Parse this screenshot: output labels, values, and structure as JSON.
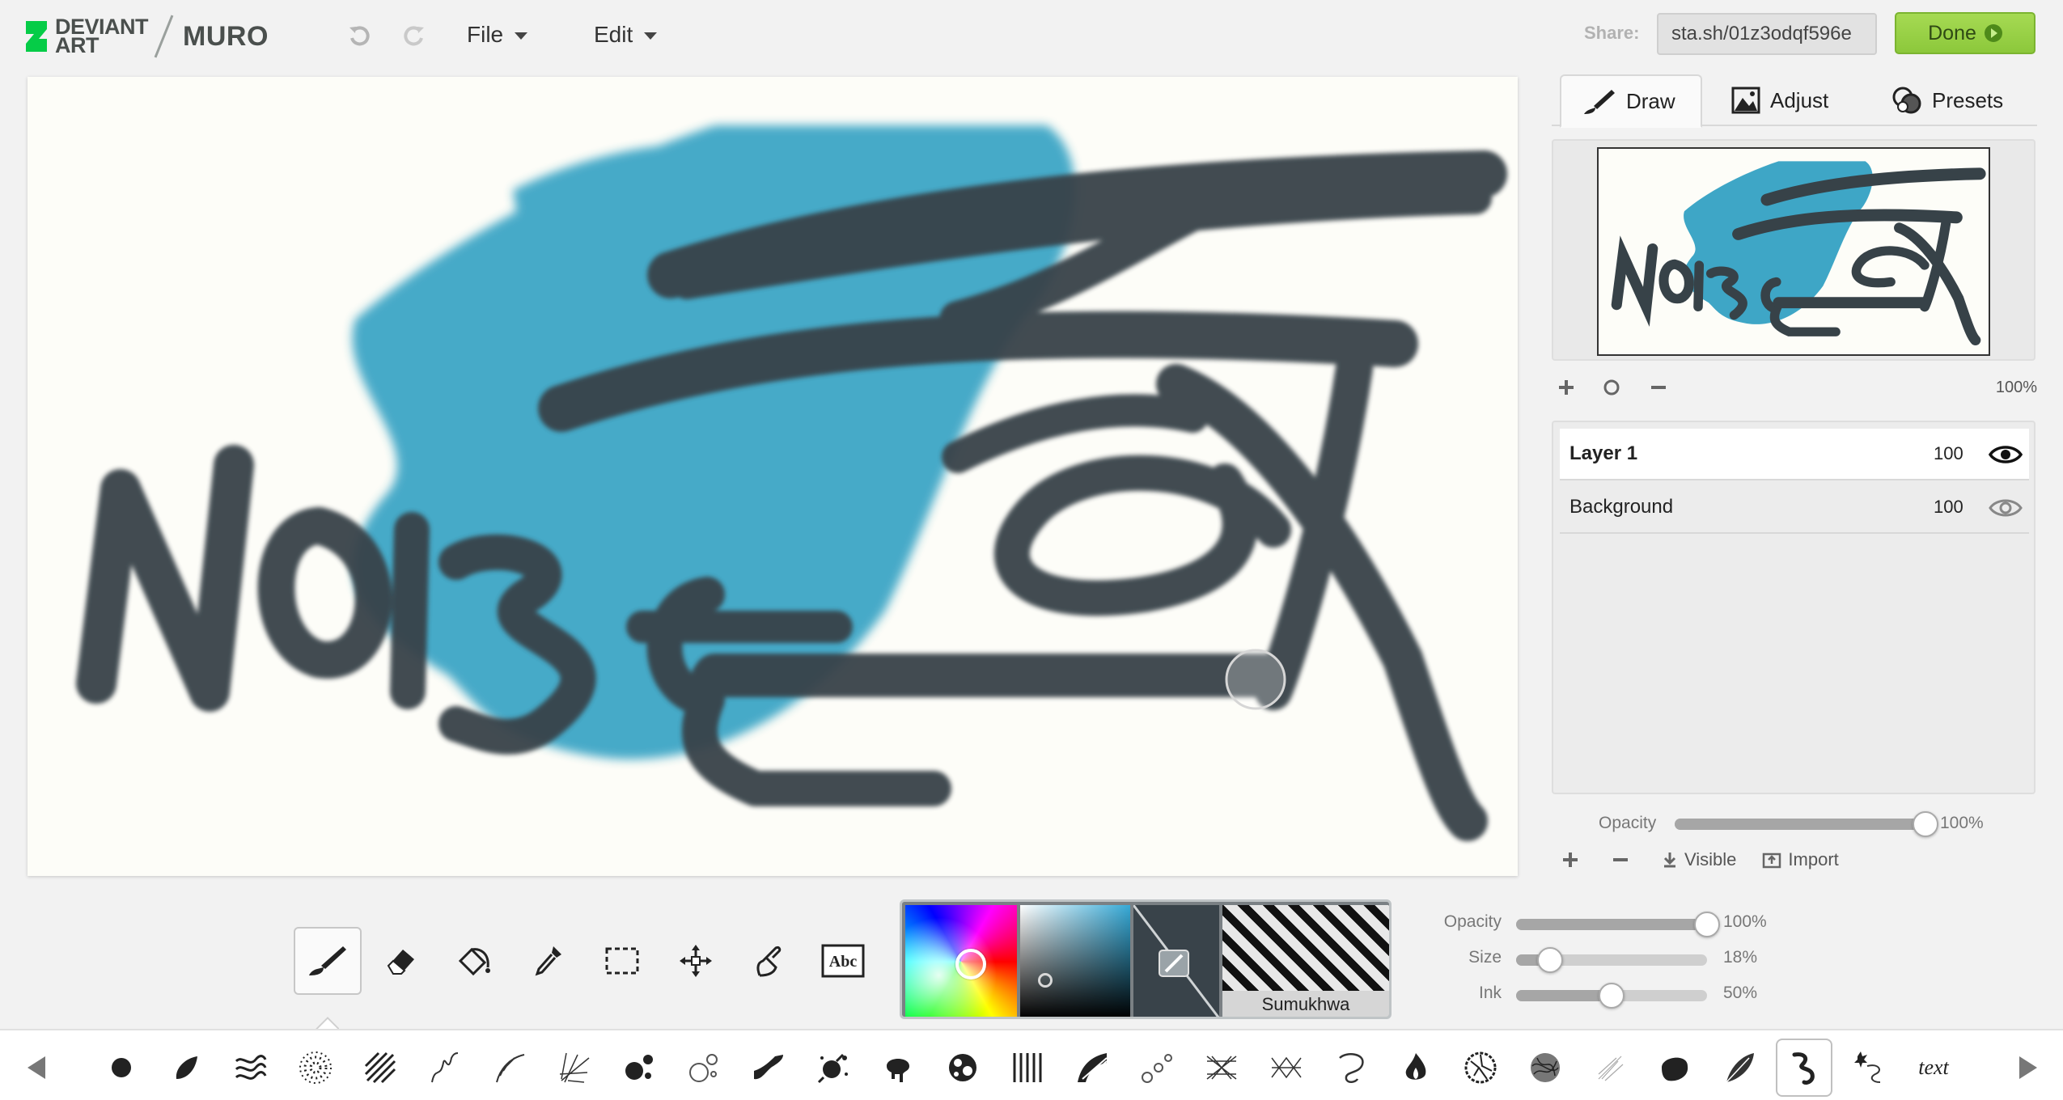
{
  "header": {
    "logo_line1": "DEVIANT",
    "logo_line2": "ART",
    "app_name": "MURO",
    "menus": {
      "file": "File",
      "edit": "Edit"
    },
    "share_label": "Share:",
    "share_url": "sta.sh/01z3odqf596e",
    "done_label": "Done"
  },
  "panel": {
    "tabs": {
      "draw": "Draw",
      "adjust": "Adjust",
      "presets": "Presets"
    },
    "zoom": "100%",
    "layers": [
      {
        "name": "Layer 1",
        "opacity": "100",
        "visible": true,
        "selected": true
      },
      {
        "name": "Background",
        "opacity": "100",
        "visible": true,
        "selected": false
      }
    ],
    "layer_opacity_label": "Opacity",
    "layer_opacity_value": "100%",
    "layer_opacity_fraction": 1.0,
    "visible_label": "Visible",
    "import_label": "Import"
  },
  "tools": [
    "brush-tool",
    "eraser-tool",
    "fill-tool",
    "eyedropper-tool",
    "select-tool",
    "move-tool",
    "smudge-tool",
    "text-tool"
  ],
  "color": {
    "brush_name": "Sumukhwa",
    "primary": "#36a9d6",
    "secondary": "#39434a"
  },
  "brush_settings": {
    "opacity": {
      "label": "Opacity",
      "value": "100%",
      "fraction": 1.0
    },
    "size": {
      "label": "Size",
      "value": "18%",
      "fraction": 0.18
    },
    "ink": {
      "label": "Ink",
      "value": "50%",
      "fraction": 0.5
    }
  },
  "brush_strip": {
    "text_brush_label": "text"
  },
  "canvas_text": "NOISE"
}
